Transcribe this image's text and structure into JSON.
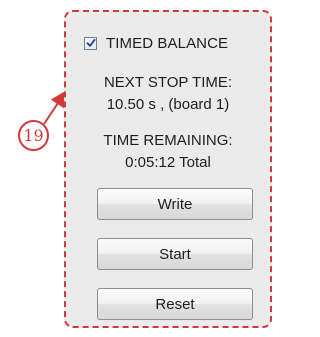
{
  "callout": {
    "number": "19",
    "color": "#d23a3a"
  },
  "panel": {
    "checkbox": {
      "label": "TIMED BALANCE",
      "checked": true,
      "icon": "checkmark-icon"
    },
    "next_stop": {
      "heading": "NEXT STOP TIME:",
      "value": "10.50 s , (board 1)"
    },
    "remaining": {
      "heading": "TIME REMAINING:",
      "value": "0:05:12 Total"
    },
    "buttons": {
      "write": "Write",
      "start": "Start",
      "reset": "Reset"
    }
  }
}
